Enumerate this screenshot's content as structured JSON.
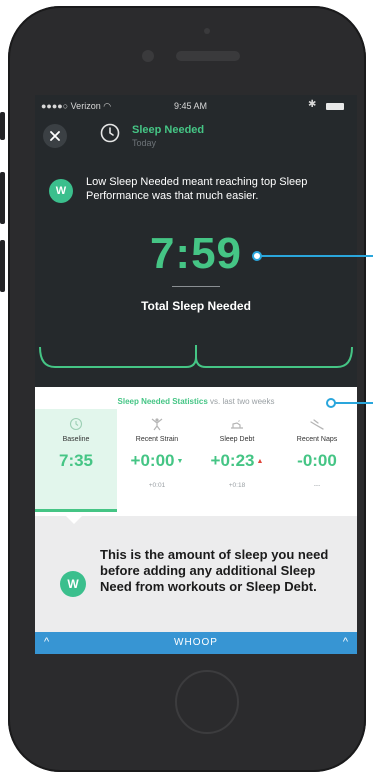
{
  "status_bar": {
    "carrier": "●●●●○ Verizon ",
    "time": "9:45 AM"
  },
  "header": {
    "title": "Sleep Needed",
    "subtitle": "Today"
  },
  "insight": {
    "badge": "W",
    "text": "Low Sleep Needed meant reaching top Sleep Performance was that much easier."
  },
  "summary": {
    "value": "7:59",
    "label": "Total Sleep Needed"
  },
  "stats": {
    "header_highlight": "Sleep Needed Statistics",
    "header_rest": " vs. last two weeks",
    "columns": [
      {
        "label": "Baseline",
        "value": "7:35",
        "sub": "",
        "icon": "clock-icon"
      },
      {
        "label": "Recent Strain",
        "value": "+0:00",
        "sub": "+0:01",
        "icon": "strain-figure-icon",
        "trend": "down"
      },
      {
        "label": "Sleep Debt",
        "value": "+0:23",
        "sub": "+0:18",
        "icon": "sleep-debt-icon",
        "trend": "up"
      },
      {
        "label": "Recent Naps",
        "value": "-0:00",
        "sub": "---",
        "icon": "nap-icon"
      }
    ]
  },
  "info": {
    "badge": "W",
    "text": "This is the amount of sleep you need before adding any additional Sleep Need from workouts or Sleep Debt."
  },
  "footer": {
    "brand": "WHOOP"
  },
  "colors": {
    "accent": "#45c585",
    "footer": "#3795d3",
    "callout": "#2aa6dc",
    "trend_up": "#e0453a"
  }
}
